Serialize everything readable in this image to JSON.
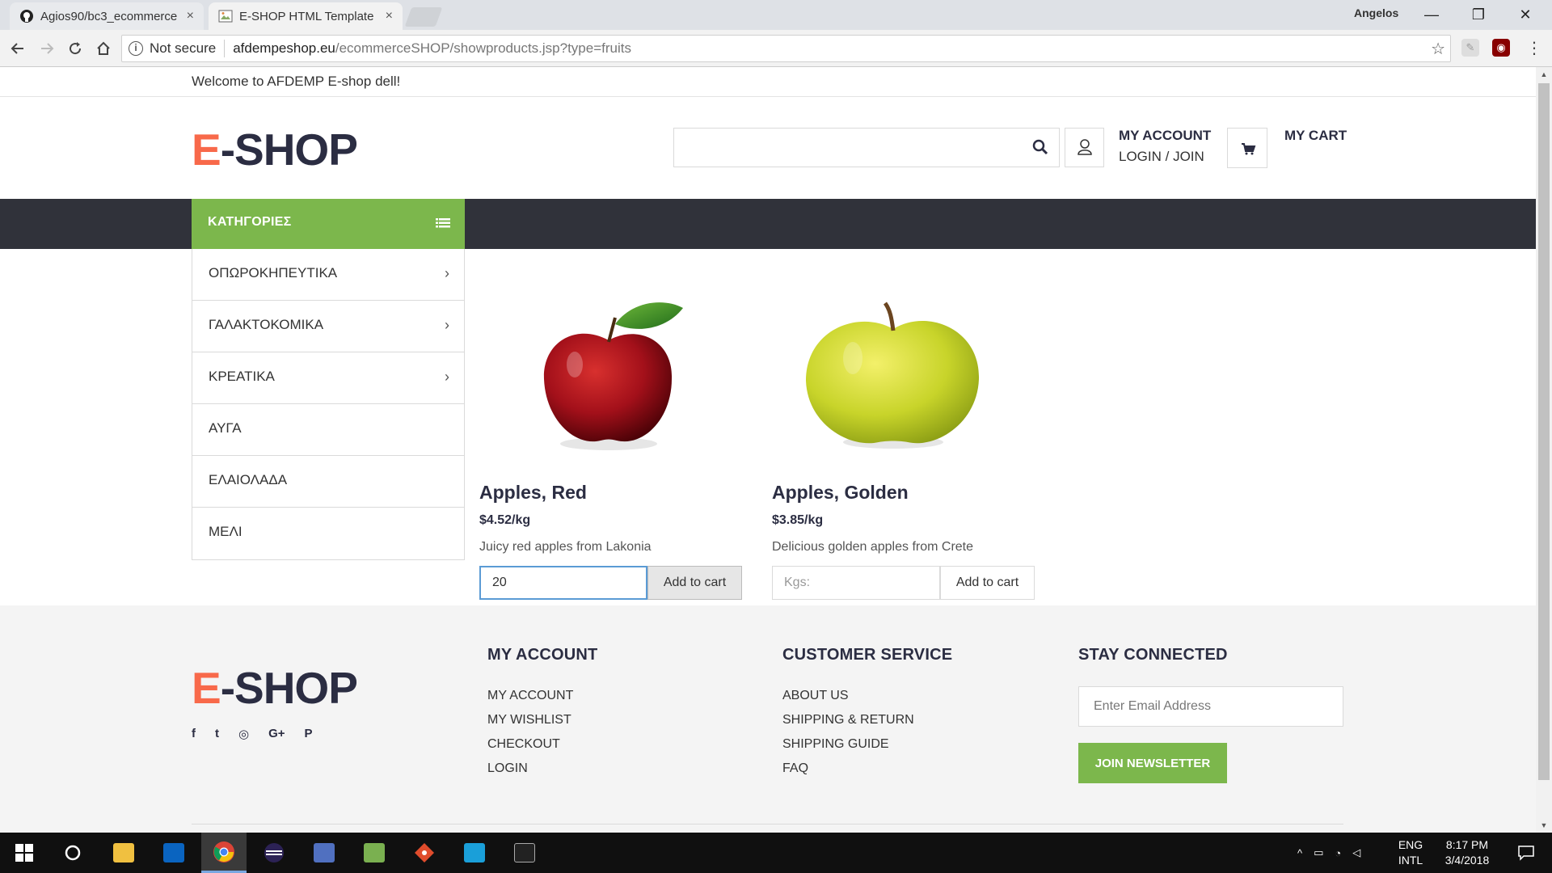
{
  "browser": {
    "tabs": [
      {
        "title": "Agios90/bc3_ecommerce",
        "close": "×",
        "icon": "github-icon"
      },
      {
        "title": "E-SHOP HTML Template",
        "close": "×",
        "icon": "page-favicon-icon"
      }
    ],
    "profile_name": "Angelos",
    "window_controls": {
      "minimize": "—",
      "restore": "❐",
      "close": "✕"
    },
    "security_label": "Not secure",
    "url_host": "afdempeshop.eu",
    "url_path": "/ecommerceSHOP/showproducts.jsp?type=fruits"
  },
  "site": {
    "welcome_text": "Welcome to AFDEMP E-shop dell!",
    "logo_letter": "E",
    "logo_rest": "-SHOP",
    "search": {
      "value": "",
      "placeholder": ""
    },
    "account": {
      "title": "MY ACCOUNT",
      "subtitle": "LOGIN / JOIN"
    },
    "cart_label": "MY CART",
    "colors": {
      "brand_orange": "#f8694a",
      "accent_green": "#7cb74c",
      "nav_dark": "#30323a",
      "heading": "#2b2d42"
    }
  },
  "categories": {
    "header": "ΚΑΤΗΓΟΡΙΕΣ",
    "items": [
      {
        "label": "ΟΠΩΡΟΚΗΠΕΥΤΙΚΑ",
        "chevron": "›"
      },
      {
        "label": "ΓΑΛΑΚΤΟΚΟΜΙΚΑ",
        "chevron": "›"
      },
      {
        "label": "ΚΡΕΑΤΙΚΑ",
        "chevron": "›"
      },
      {
        "label": "ΑΥΓΑ",
        "chevron": ""
      },
      {
        "label": "ΕΛΑΙΟΛΑΔΑ",
        "chevron": ""
      },
      {
        "label": "ΜΕΛΙ",
        "chevron": ""
      }
    ]
  },
  "products": [
    {
      "name": "Apples, Red",
      "price": "$4.52/kg",
      "description": "Juicy red apples from Lakonia",
      "qty_value": "20",
      "qty_placeholder": "Kgs:",
      "button": "Add to cart"
    },
    {
      "name": "Apples, Golden",
      "price": "$3.85/kg",
      "description": "Delicious golden apples from Crete",
      "qty_value": "",
      "qty_placeholder": "Kgs:",
      "button": "Add to cart"
    }
  ],
  "footer": {
    "account": {
      "title": "MY ACCOUNT",
      "links": [
        "MY ACCOUNT",
        "MY WISHLIST",
        "CHECKOUT",
        "LOGIN"
      ]
    },
    "service": {
      "title": "CUSTOMER SERVICE",
      "links": [
        "ABOUT US",
        "SHIPPING & RETURN",
        "SHIPPING GUIDE",
        "FAQ"
      ]
    },
    "connect": {
      "title": "STAY CONNECTED",
      "email_placeholder": "Enter Email Address",
      "button": "JOIN NEWSLETTER"
    },
    "social": [
      "f",
      "t",
      "◎",
      "G+",
      "P"
    ]
  },
  "taskbar": {
    "language": "ENG",
    "layout": "INTL",
    "time": "8:17 PM",
    "date": "3/4/2018"
  }
}
